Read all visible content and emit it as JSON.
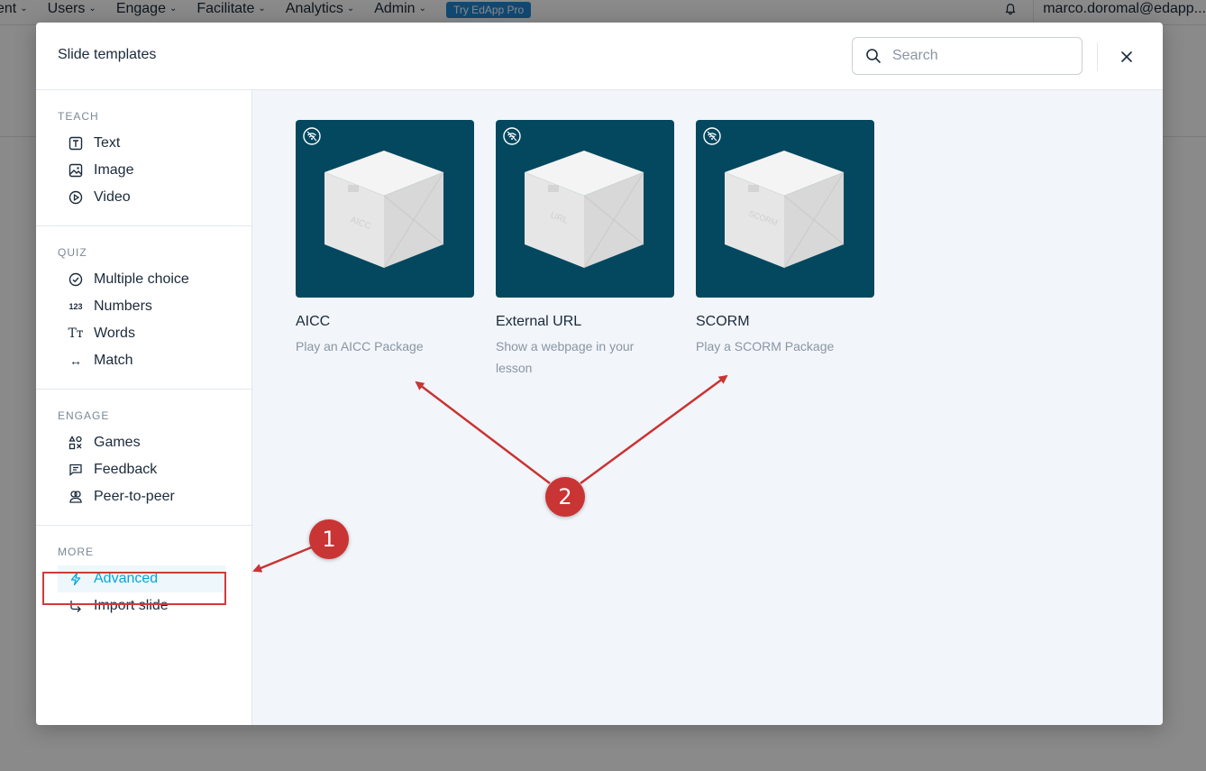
{
  "background": {
    "nav": [
      {
        "label": "ent"
      },
      {
        "label": "Users"
      },
      {
        "label": "Engage"
      },
      {
        "label": "Facilitate"
      },
      {
        "label": "Analytics"
      },
      {
        "label": "Admin"
      }
    ],
    "pro_label": "Try EdApp Pro",
    "user_email": "marco.doromal@edapp..."
  },
  "modal": {
    "title": "Slide templates",
    "search_placeholder": "Search",
    "close_icon": "close-icon"
  },
  "sidebar": {
    "sections": [
      {
        "title": "TEACH",
        "items": [
          {
            "label": "Text",
            "icon": "text-icon"
          },
          {
            "label": "Image",
            "icon": "image-icon"
          },
          {
            "label": "Video",
            "icon": "video-icon"
          }
        ]
      },
      {
        "title": "QUIZ",
        "items": [
          {
            "label": "Multiple choice",
            "icon": "check-circle-icon"
          },
          {
            "label": "Numbers",
            "icon": "numbers-icon"
          },
          {
            "label": "Words",
            "icon": "words-icon"
          },
          {
            "label": "Match",
            "icon": "match-arrows-icon"
          }
        ]
      },
      {
        "title": "ENGAGE",
        "items": [
          {
            "label": "Games",
            "icon": "games-icon"
          },
          {
            "label": "Feedback",
            "icon": "feedback-icon"
          },
          {
            "label": "Peer-to-peer",
            "icon": "peer-icon"
          }
        ]
      },
      {
        "title": "MORE",
        "items": [
          {
            "label": "Advanced",
            "icon": "lightning-icon",
            "active": true
          },
          {
            "label": "Import slide",
            "icon": "import-arrow-icon"
          }
        ]
      }
    ]
  },
  "templates": [
    {
      "title": "AICC",
      "description": "Play an AICC Package",
      "box_label": "AICC"
    },
    {
      "title": "External URL",
      "description": "Show a webpage in your lesson",
      "box_label": "URL"
    },
    {
      "title": "SCORM",
      "description": "Play a SCORM Package",
      "box_label": "SCORM"
    }
  ],
  "annotations": {
    "step1": "1",
    "step2": "2",
    "color": "#c93434"
  }
}
